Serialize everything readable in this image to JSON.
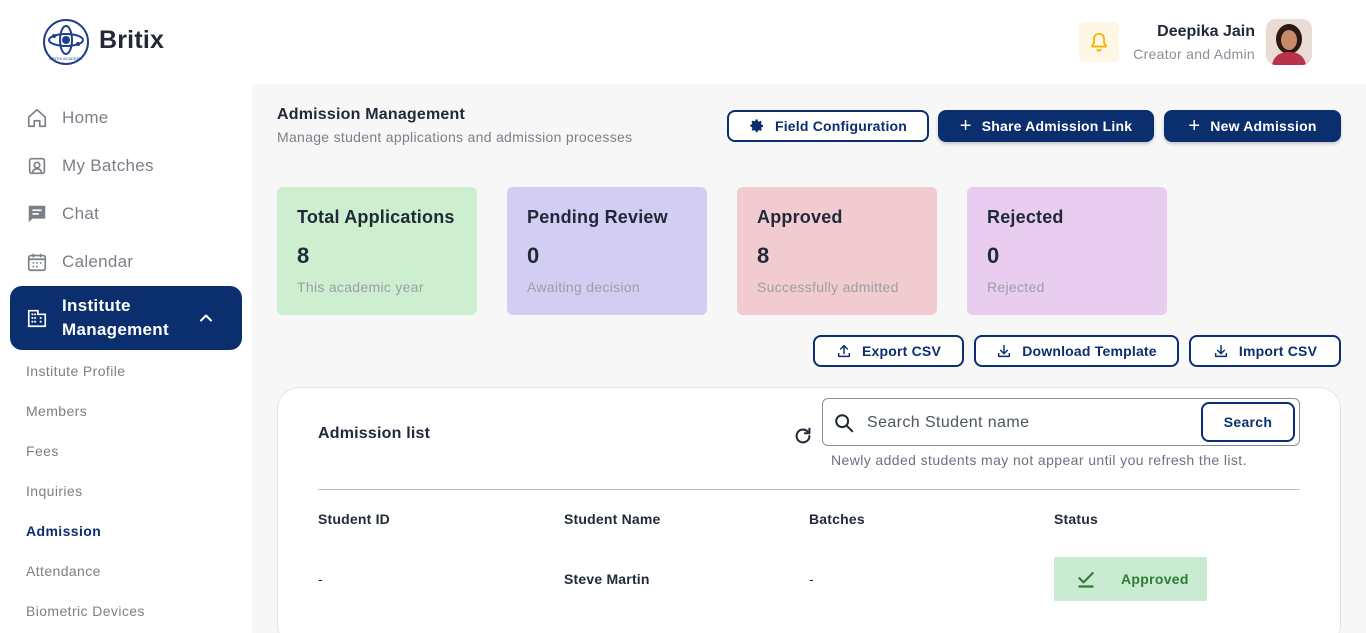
{
  "app": {
    "brand": "Britix",
    "logo_text": "BRITIX ACADEMY"
  },
  "user": {
    "name": "Deepika Jain",
    "role": "Creator and Admin"
  },
  "sidebar": {
    "items": [
      {
        "label": "Home",
        "icon": "home-icon"
      },
      {
        "label": "My Batches",
        "icon": "batches-icon"
      },
      {
        "label": "Chat",
        "icon": "chat-icon"
      },
      {
        "label": "Calendar",
        "icon": "calendar-icon"
      }
    ],
    "active_section": {
      "label_line1": "Institute",
      "label_line2": "Management",
      "icon": "building-icon",
      "expanded": true
    },
    "sub_items": [
      {
        "label": "Institute Profile",
        "active": false
      },
      {
        "label": "Members",
        "active": false
      },
      {
        "label": "Fees",
        "active": false
      },
      {
        "label": "Inquiries",
        "active": false
      },
      {
        "label": "Admission",
        "active": true
      },
      {
        "label": "Attendance",
        "active": false
      },
      {
        "label": "Biometric Devices",
        "active": false
      }
    ]
  },
  "page": {
    "title": "Admission Management",
    "subtitle": "Manage student applications and admission processes"
  },
  "actions": {
    "field_configuration": "Field Configuration",
    "share_link": "Share Admission Link",
    "new_admission": "New Admission",
    "export_csv": "Export CSV",
    "download_template": "Download Template",
    "import_csv": "Import CSV"
  },
  "stats": [
    {
      "title": "Total Applications",
      "value": "8",
      "sub": "This academic year",
      "color": "#cdeecf"
    },
    {
      "title": "Pending Review",
      "value": "0",
      "sub": "Awaiting decision",
      "color": "#d3cdf3"
    },
    {
      "title": "Approved",
      "value": "8",
      "sub": "Successfully admitted",
      "color": "#f1cbcf"
    },
    {
      "title": "Rejected",
      "value": "0",
      "sub": "Rejected",
      "color": "#e8cdf1"
    }
  ],
  "admission_list": {
    "title": "Admission list",
    "search_placeholder": "Search Student name",
    "search_button": "Search",
    "hint": "Newly added students may not appear until you refresh the list.",
    "columns": [
      "Student ID",
      "Student Name",
      "Batches",
      "Status"
    ],
    "rows": [
      {
        "student_id": "-",
        "student_name": "Steve Martin",
        "batches": "-",
        "status": "Approved"
      }
    ]
  },
  "colors": {
    "primary": "#0b2e6f",
    "approved_bg": "#c8ebd1",
    "approved_text": "#2e7d32",
    "bell": "#f5b301"
  }
}
